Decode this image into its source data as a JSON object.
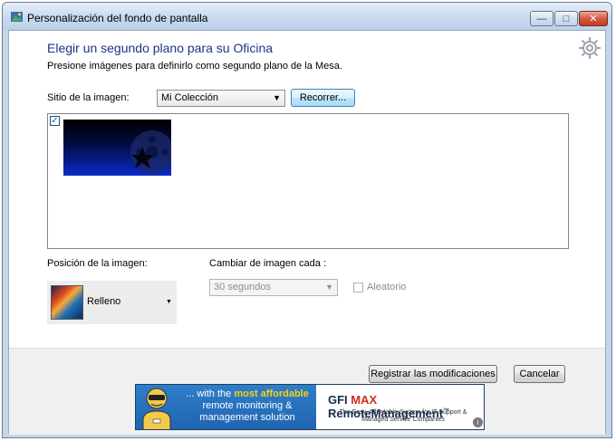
{
  "window": {
    "title": "Personalización del fondo de pantalla",
    "min_label": "—",
    "max_label": "□",
    "close_label": "✕"
  },
  "header": {
    "title": "Elegir un segundo plano para su Oficina",
    "subtitle": "Presione imágenes para definirlo como segundo plano de la Mesa."
  },
  "image_source": {
    "label": "Sitio de la imagen:",
    "selected": "Mi Colección",
    "browse_label": "Recorrer..."
  },
  "gallery": {
    "items": [
      {
        "checked": true,
        "check_glyph": "✓"
      }
    ]
  },
  "position": {
    "label": "Posición de la imagen:",
    "selected": "Relleno"
  },
  "interval": {
    "label": "Cambiar de imagen cada :",
    "selected": "30 segundos",
    "random_label": "Aleatorio",
    "random_checked": false
  },
  "actions": {
    "save_label": "Registrar las modificaciones",
    "cancel_label": "Cancelar"
  },
  "ad": {
    "line_prefix": "... with the ",
    "line_highlight": "most affordable",
    "line_rest": "remote monitoring & management solution",
    "brand_gfi": "GFI ",
    "brand_max": "MAX ",
    "brand_product": "RemoteManagement",
    "brand_tm": "™",
    "tagline": "The Easy, Affordable System for IT Support & Managed Service Companies",
    "info_glyph": "i"
  },
  "colors": {
    "accent_heading": "#1e3287",
    "ad_blue": "#1f64b0",
    "ad_highlight": "#f6d311"
  },
  "icons": {
    "app": "wallpaper-app-icon",
    "settings": "gear-icon",
    "dropdown": "chevron-down-icon"
  }
}
